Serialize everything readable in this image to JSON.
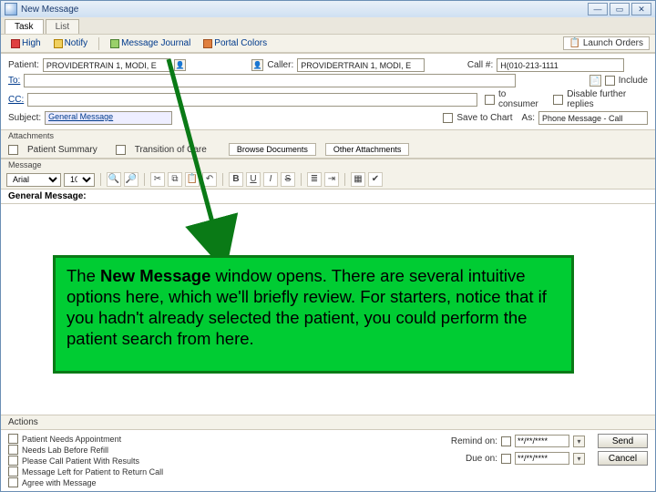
{
  "window": {
    "title": "New Message"
  },
  "winbtns": {
    "min": "—",
    "max": "▭",
    "close": "✕"
  },
  "tabs": {
    "task": "Task",
    "list": "List"
  },
  "toolbar": {
    "high": "High",
    "notify": "Notify",
    "journal": "Message Journal",
    "portal": "Portal Colors",
    "launch": "Launch Orders"
  },
  "patientRow": {
    "patientLabel": "Patient:",
    "patientValue": "PROVIDERTRAIN 1, MODI, E",
    "callerLabel": "Caller:",
    "callerValue": "PROVIDERTRAIN 1, MODI, E",
    "callNoLabel": "Call #:",
    "callNoValue": "H(010-213-1111"
  },
  "toRow": {
    "toLabel": "To:",
    "docLabel": "Include",
    "consumerLabel": "to consumer",
    "disableLabel": "Disable further replies"
  },
  "ccRow": {
    "ccLabel": "CC:"
  },
  "subjectRow": {
    "label": "Subject:",
    "value": "General Message",
    "saveChartLabel": "Save to Chart",
    "asLabel": "As:",
    "asValue": "Phone Message - Call"
  },
  "attachLabel": "Attachments",
  "attach": {
    "patientSummary": "Patient Summary",
    "transition": "Transition of Care",
    "browse": "Browse Documents",
    "other": "Other Attachments"
  },
  "msgLabel": "Message",
  "editor": {
    "font": "Arial",
    "size": "10"
  },
  "msgHead": "General Message:",
  "actionsLabel": "Actions",
  "actions": {
    "a1": "Patient Needs Appointment",
    "a2": "Needs Lab Before Refill",
    "a3": "Please Call Patient With Results",
    "a4": "Message Left for Patient to Return Call",
    "a5": "Agree with Message"
  },
  "rightActions": {
    "remindLabel": "Remind on:",
    "dueLabel": "Due on:",
    "datePlaceholder": "**/**/****",
    "send": "Send",
    "cancel": "Cancel"
  },
  "callout": {
    "pre": "The ",
    "bold": "New Message",
    "rest": " window opens.  There are several intuitive options here, which we'll briefly review.  For starters, notice that if you hadn't already selected the patient, you could perform the patient search from here."
  }
}
